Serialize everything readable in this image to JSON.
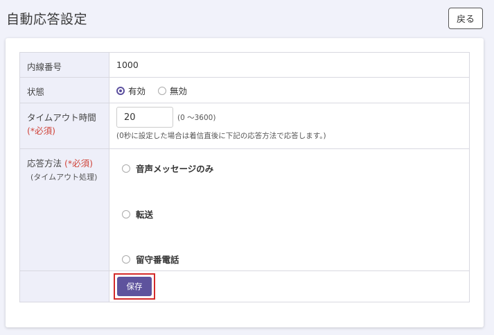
{
  "header": {
    "title": "自動応答設定",
    "back_label": "戻る"
  },
  "form": {
    "extension": {
      "label": "内線番号",
      "value": "1000"
    },
    "status": {
      "label": "状態",
      "options": [
        {
          "label": "有効",
          "selected": true
        },
        {
          "label": "無効",
          "selected": false
        }
      ]
    },
    "timeout": {
      "label": "タイムアウト時間",
      "required": "(*必須)",
      "value": "20",
      "range_hint": "(0 ～3600)",
      "note": "(0秒に設定した場合は着信直後に下記の応答方法で応答します。)"
    },
    "method": {
      "label": "応答方法",
      "required": "(*必須)",
      "sub_label": "(タイムアウト処理)",
      "options": [
        {
          "label": "音声メッセージのみ",
          "selected": false
        },
        {
          "label": "転送",
          "selected": false
        },
        {
          "label": "留守番電話",
          "selected": false
        }
      ]
    },
    "save_label": "保存"
  },
  "colors": {
    "accent": "#5e539d",
    "required": "#d0463c",
    "highlight": "#d42a2a",
    "label_bg": "#eeeff9"
  }
}
